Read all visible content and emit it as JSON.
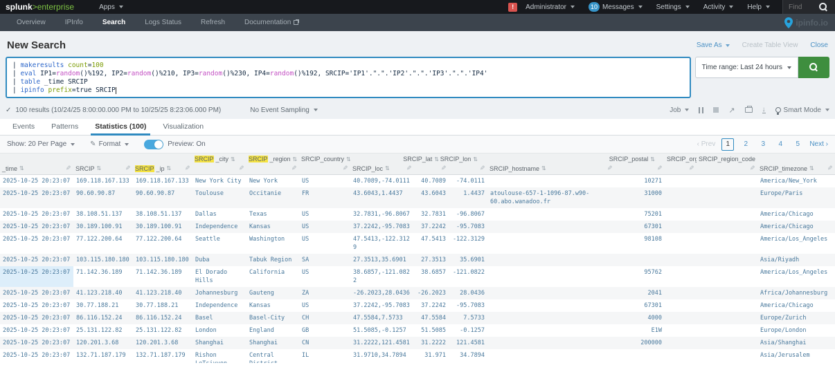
{
  "topbar": {
    "splunk": "splunk",
    "gt": ">",
    "enterprise": "enterprise",
    "apps": "Apps",
    "alert": "!",
    "administrator": "Administrator",
    "msg_count": "10",
    "messages": "Messages",
    "settings": "Settings",
    "activity": "Activity",
    "help": "Help",
    "find_placeholder": "Find"
  },
  "appnav": {
    "items": [
      {
        "label": "Overview",
        "active": false,
        "external": false
      },
      {
        "label": "IPInfo",
        "active": false,
        "external": false
      },
      {
        "label": "Search",
        "active": true,
        "external": false
      },
      {
        "label": "Logs Status",
        "active": false,
        "external": false
      },
      {
        "label": "Refresh",
        "active": false,
        "external": false
      },
      {
        "label": "Documentation",
        "active": false,
        "external": true
      }
    ],
    "brand": "ipinfo.io"
  },
  "page": {
    "title": "New Search",
    "save_as": "Save As",
    "create_table_view": "Create Table View",
    "close": "Close"
  },
  "searchbar": {
    "time_range": "Time range: Last 24 hours",
    "lines": [
      [
        {
          "t": "| ",
          "k": "p"
        },
        {
          "t": "makeresults",
          "k": "c"
        },
        {
          "t": " ",
          "k": "p"
        },
        {
          "t": "count",
          "k": "g"
        },
        {
          "t": "=",
          "k": "p"
        },
        {
          "t": "100",
          "k": "g"
        }
      ],
      [
        {
          "t": "| ",
          "k": "p"
        },
        {
          "t": "eval",
          "k": "c"
        },
        {
          "t": " IP1=",
          "k": "p"
        },
        {
          "t": "random",
          "k": "f"
        },
        {
          "t": "()%192, IP2=",
          "k": "p"
        },
        {
          "t": "random",
          "k": "f"
        },
        {
          "t": "()%210, IP3=",
          "k": "p"
        },
        {
          "t": "random",
          "k": "f"
        },
        {
          "t": "()%230, IP4=",
          "k": "p"
        },
        {
          "t": "random",
          "k": "f"
        },
        {
          "t": "()%192, SRCIP='IP1'.\".\".'IP2'.\".\".'IP3'.\".\".'IP4'",
          "k": "p"
        }
      ],
      [
        {
          "t": "| ",
          "k": "p"
        },
        {
          "t": "table",
          "k": "c"
        },
        {
          "t": " _time SRCIP",
          "k": "p"
        }
      ],
      [
        {
          "t": "| ",
          "k": "p"
        },
        {
          "t": "ipinfo",
          "k": "c"
        },
        {
          "t": " ",
          "k": "p"
        },
        {
          "t": "prefix",
          "k": "g"
        },
        {
          "t": "=true SRCIP",
          "k": "p"
        }
      ]
    ]
  },
  "status": {
    "check": "✓",
    "results": "100 results (10/24/25 8:00:00.000 PM to 10/25/25 8:23:06.000 PM)",
    "sampling": "No Event Sampling",
    "job": "Job",
    "smart_mode": "Smart Mode"
  },
  "tabs": [
    {
      "label": "Events",
      "active": false
    },
    {
      "label": "Patterns",
      "active": false
    },
    {
      "label": "Statistics (100)",
      "active": true
    },
    {
      "label": "Visualization",
      "active": false
    }
  ],
  "toolbar": {
    "show_per_page": "Show: 20 Per Page",
    "format": "Format",
    "preview": "Preview: On",
    "pagination": {
      "prev": "‹ Prev",
      "pages": [
        "1",
        "2",
        "3",
        "4",
        "5"
      ],
      "active": "1",
      "next": "Next ›"
    }
  },
  "icons": {
    "sort": "⇅",
    "pencil": "✎",
    "share": "↗",
    "download": "↓"
  },
  "colors": {
    "accent_blue": "#2f8ac0",
    "link_blue": "#4a90c4",
    "button_green": "#3e8e3e",
    "brand_green": "#7dc243",
    "badge_red": "#d9534f",
    "badge_blue": "#3794c8",
    "toggle_blue": "#49a8de",
    "header_highlight": "#f5e342",
    "cell_text": "#48789c"
  },
  "table": {
    "columns": [
      {
        "label": "_time",
        "pos": "bottom",
        "align": "left",
        "hl": ""
      },
      {
        "label": "SRCIP",
        "pos": "bottom",
        "align": "left",
        "hl": ""
      },
      {
        "label": "SRCIP_ip",
        "pos": "bottom",
        "align": "left",
        "hl": "SRCIP"
      },
      {
        "label": "SRCIP_city",
        "pos": "top",
        "align": "left",
        "hl": "SRCIP"
      },
      {
        "label": "SRCIP_region",
        "pos": "top",
        "align": "left",
        "hl": "SRCIP"
      },
      {
        "label": "SRCIP_country",
        "pos": "top",
        "align": "left",
        "hl": ""
      },
      {
        "label": "SRCIP_loc",
        "pos": "bottom",
        "align": "left",
        "hl": ""
      },
      {
        "label": "SRCIP_lat",
        "pos": "top",
        "align": "right",
        "hl": ""
      },
      {
        "label": "SRCIP_lon",
        "pos": "top",
        "align": "right",
        "hl": ""
      },
      {
        "label": "SRCIP_hostname",
        "pos": "bottom",
        "align": "left",
        "hl": ""
      },
      {
        "label": "SRCIP_postal",
        "pos": "top",
        "align": "right",
        "hl": ""
      },
      {
        "label": "SRCIP_org",
        "pos": "top",
        "align": "left",
        "hl": ""
      },
      {
        "label": "SRCIP_region_code",
        "pos": "top",
        "align": "left",
        "hl": ""
      },
      {
        "label": "SRCIP_timezone",
        "pos": "bottom",
        "align": "left",
        "hl": ""
      }
    ],
    "hover_row": 7,
    "hover_col": 0,
    "rows": [
      [
        "2025-10-25 20:23:07",
        "169.118.167.133",
        "169.118.167.133",
        "New York City",
        "New York",
        "US",
        "40.7089,-74.0111",
        "40.7089",
        "-74.0111",
        "",
        "10271",
        "",
        "",
        "America/New_York"
      ],
      [
        "2025-10-25 20:23:07",
        "90.60.90.87",
        "90.60.90.87",
        "Toulouse",
        "Occitanie",
        "FR",
        "43.6043,1.4437",
        "43.6043",
        "1.4437",
        "atoulouse-657-1-1096-87.w90-60.abo.wanadoo.fr",
        "31000",
        "",
        "",
        "Europe/Paris"
      ],
      [
        "2025-10-25 20:23:07",
        "38.108.51.137",
        "38.108.51.137",
        "Dallas",
        "Texas",
        "US",
        "32.7831,-96.8067",
        "32.7831",
        "-96.8067",
        "",
        "75201",
        "",
        "",
        "America/Chicago"
      ],
      [
        "2025-10-25 20:23:07",
        "30.189.100.91",
        "30.189.100.91",
        "Independence",
        "Kansas",
        "US",
        "37.2242,-95.7083",
        "37.2242",
        "-95.7083",
        "",
        "67301",
        "",
        "",
        "America/Chicago"
      ],
      [
        "2025-10-25 20:23:07",
        "77.122.200.64",
        "77.122.200.64",
        "Seattle",
        "Washington",
        "US",
        "47.5413,-122.3129",
        "47.5413",
        "-122.3129",
        "",
        "98108",
        "",
        "",
        "America/Los_Angeles"
      ],
      [
        "2025-10-25 20:23:07",
        "103.115.180.180",
        "103.115.180.180",
        "Duba",
        "Tabuk Region",
        "SA",
        "27.3513,35.6901",
        "27.3513",
        "35.6901",
        "",
        "",
        "",
        "",
        "Asia/Riyadh"
      ],
      [
        "2025-10-25 20:23:07",
        "71.142.36.189",
        "71.142.36.189",
        "El Dorado Hills",
        "California",
        "US",
        "38.6857,-121.0822",
        "38.6857",
        "-121.0822",
        "",
        "95762",
        "",
        "",
        "America/Los_Angeles"
      ],
      [
        "2025-10-25 20:23:07",
        "41.123.218.40",
        "41.123.218.40",
        "Johannesburg",
        "Gauteng",
        "ZA",
        "-26.2023,28.0436",
        "-26.2023",
        "28.0436",
        "",
        "2041",
        "",
        "",
        "Africa/Johannesburg"
      ],
      [
        "2025-10-25 20:23:07",
        "30.77.188.21",
        "30.77.188.21",
        "Independence",
        "Kansas",
        "US",
        "37.2242,-95.7083",
        "37.2242",
        "-95.7083",
        "",
        "67301",
        "",
        "",
        "America/Chicago"
      ],
      [
        "2025-10-25 20:23:07",
        "86.116.152.24",
        "86.116.152.24",
        "Basel",
        "Basel-City",
        "CH",
        "47.5584,7.5733",
        "47.5584",
        "7.5733",
        "",
        "4000",
        "",
        "",
        "Europe/Zurich"
      ],
      [
        "2025-10-25 20:23:07",
        "25.131.122.82",
        "25.131.122.82",
        "London",
        "England",
        "GB",
        "51.5085,-0.1257",
        "51.5085",
        "-0.1257",
        "",
        "E1W",
        "",
        "",
        "Europe/London"
      ],
      [
        "2025-10-25 20:23:07",
        "120.201.3.68",
        "120.201.3.68",
        "Shanghai",
        "Shanghai",
        "CN",
        "31.2222,121.4581",
        "31.2222",
        "121.4581",
        "",
        "200000",
        "",
        "",
        "Asia/Shanghai"
      ],
      [
        "2025-10-25 20:23:07",
        "132.71.187.179",
        "132.71.187.179",
        "Rishon LeTsiyyon",
        "Central District",
        "IL",
        "31.9710,34.7894",
        "31.971",
        "34.7894",
        "",
        "",
        "",
        "",
        "Asia/Jerusalem"
      ]
    ]
  }
}
